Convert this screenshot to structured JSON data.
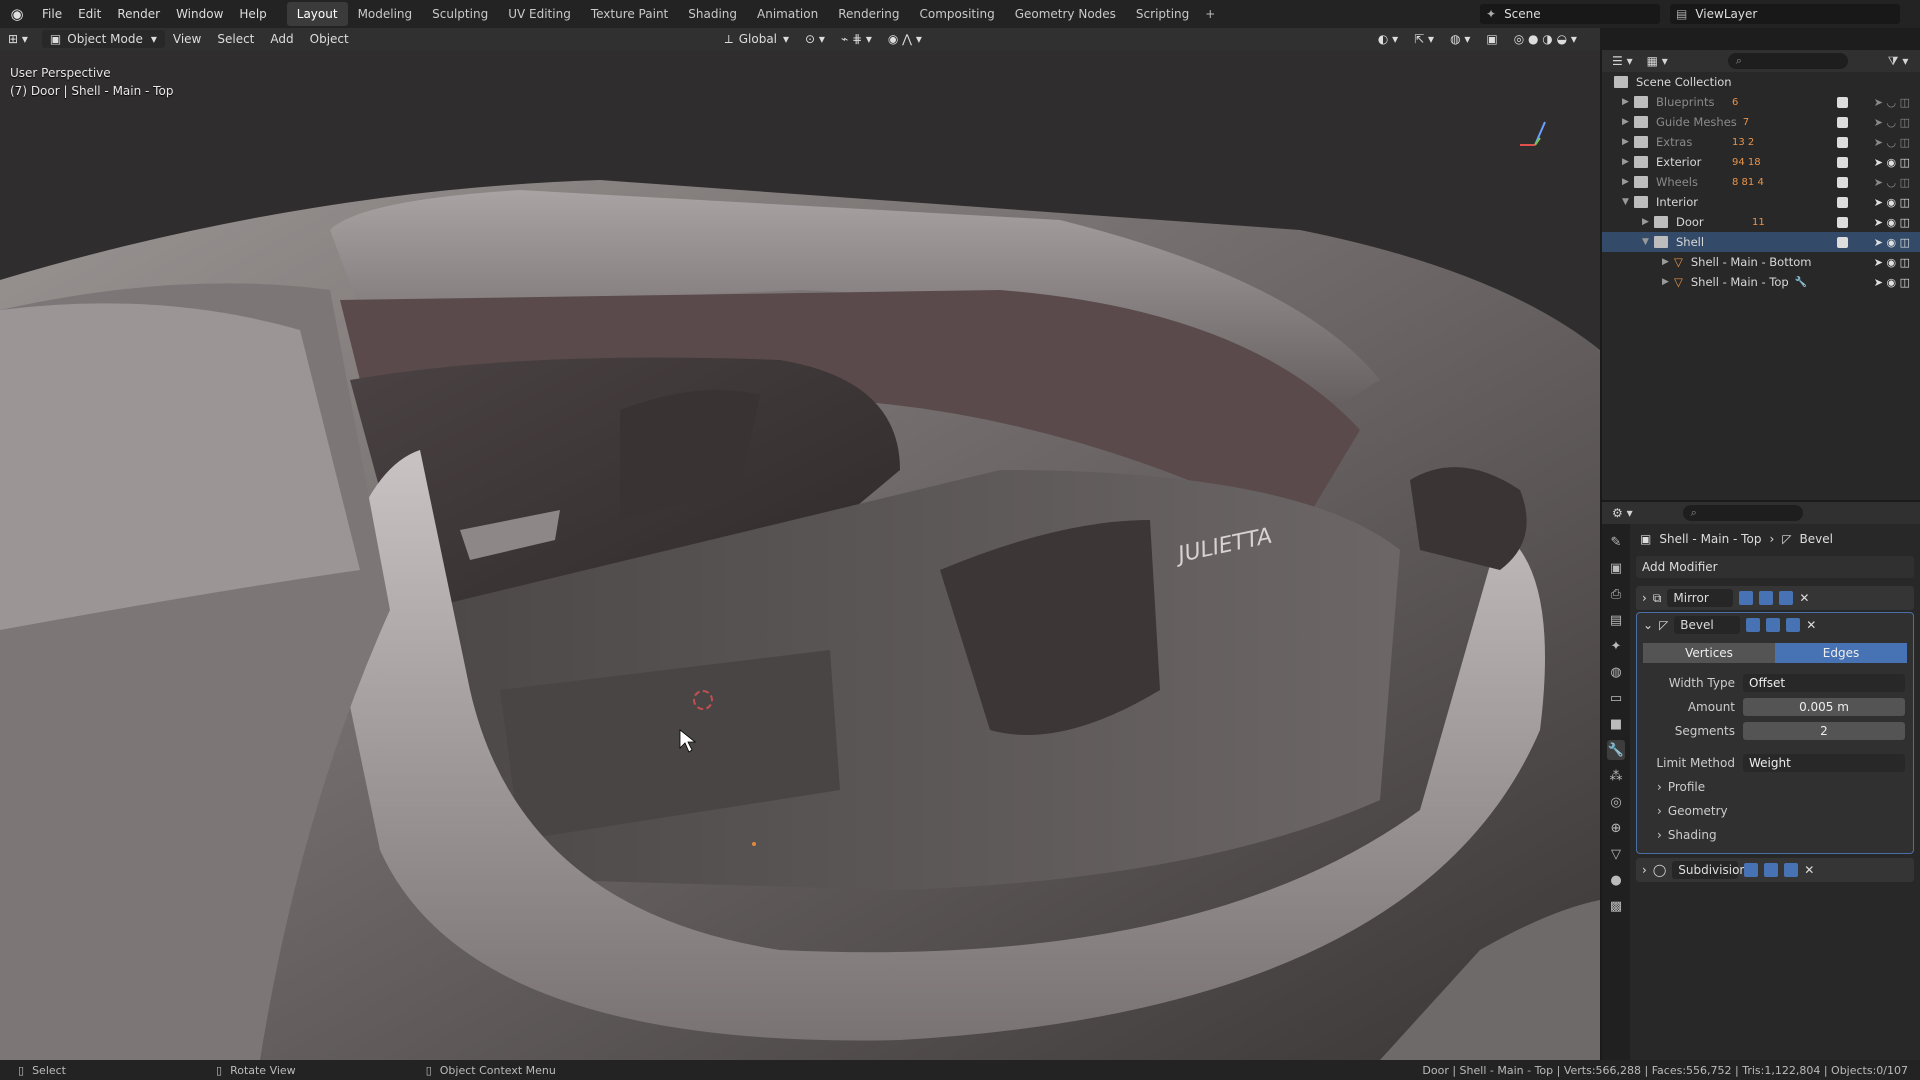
{
  "topbar": {
    "menus": [
      "File",
      "Edit",
      "Render",
      "Window",
      "Help"
    ],
    "workspaces": [
      "Layout",
      "Modeling",
      "Sculpting",
      "UV Editing",
      "Texture Paint",
      "Shading",
      "Animation",
      "Rendering",
      "Compositing",
      "Geometry Nodes",
      "Scripting"
    ],
    "active_workspace": "Layout",
    "scene": "Scene",
    "view_layer": "ViewLayer"
  },
  "viewport_header": {
    "mode": "Object Mode",
    "menus": [
      "View",
      "Select",
      "Add",
      "Object"
    ],
    "orientation": "Global"
  },
  "viewport": {
    "perspective": "User Perspective",
    "object_info": "(7) Door | Shell - Main - Top",
    "badge_text": "JULIETTA"
  },
  "outliner": {
    "root": "Scene Collection",
    "rows": [
      {
        "label": "Blueprints",
        "count": "6",
        "dim": true
      },
      {
        "label": "Guide Meshes",
        "count": "7",
        "dim": true
      },
      {
        "label": "Extras",
        "count": "13  2",
        "dim": true
      },
      {
        "label": "Exterior",
        "count": "94  18",
        "dim": false
      },
      {
        "label": "Wheels",
        "count": "8  81  4",
        "dim": true
      },
      {
        "label": "Interior",
        "count": "",
        "dim": false
      },
      {
        "label": "Door",
        "count": "11",
        "dim": false
      },
      {
        "label": "Shell",
        "count": "",
        "dim": false
      },
      {
        "label": "Shell - Main - Bottom",
        "count": "",
        "dim": false
      },
      {
        "label": "Shell - Main - Top",
        "count": "",
        "dim": false
      }
    ]
  },
  "properties": {
    "breadcrumb_object": "Shell - Main - Top",
    "breadcrumb_modifier": "Bevel",
    "add_modifier": "Add Modifier",
    "modifiers": [
      "Mirror",
      "Bevel",
      "Subdivision"
    ],
    "bevel": {
      "affect_options": [
        "Vertices",
        "Edges"
      ],
      "affect_selected": "Edges",
      "width_type_label": "Width Type",
      "width_type": "Offset",
      "amount_label": "Amount",
      "amount": "0.005 m",
      "segments_label": "Segments",
      "segments": "2",
      "limit_method_label": "Limit Method",
      "limit_method": "Weight",
      "subpanels": [
        "Profile",
        "Geometry",
        "Shading"
      ]
    }
  },
  "statusbar": {
    "select": "Select",
    "rotate": "Rotate View",
    "context": "Object Context Menu",
    "stats": "Door | Shell - Main - Top | Verts:566,288 | Faces:556,752 | Tris:1,122,804 | Objects:0/107"
  }
}
